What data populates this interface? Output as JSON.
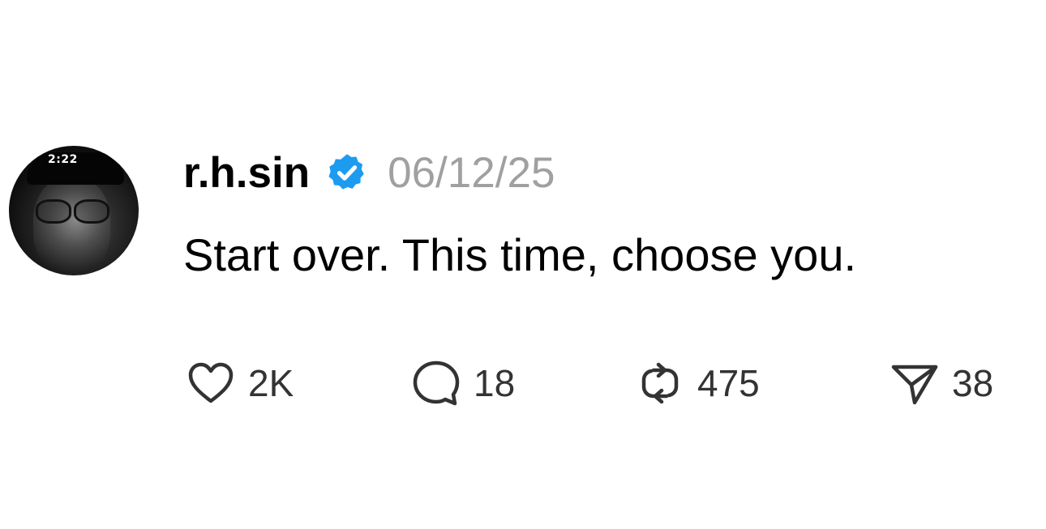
{
  "post": {
    "avatar_cap_text": "2:22",
    "username": "r.h.sin",
    "verified_icon": "verified-badge-icon",
    "date": "06/12/25",
    "text": "Start over. This time, choose you."
  },
  "actions": {
    "like": {
      "icon": "heart-icon",
      "count": "2K"
    },
    "reply": {
      "icon": "speech-bubble-icon",
      "count": "18"
    },
    "repost": {
      "icon": "repost-icon",
      "count": "475"
    },
    "share": {
      "icon": "paper-plane-icon",
      "count": "38"
    }
  },
  "colors": {
    "verified_blue": "#1d9bf0",
    "date_gray": "#a0a0a0",
    "icon_gray": "#333333",
    "text": "#000000",
    "background": "#ffffff"
  }
}
